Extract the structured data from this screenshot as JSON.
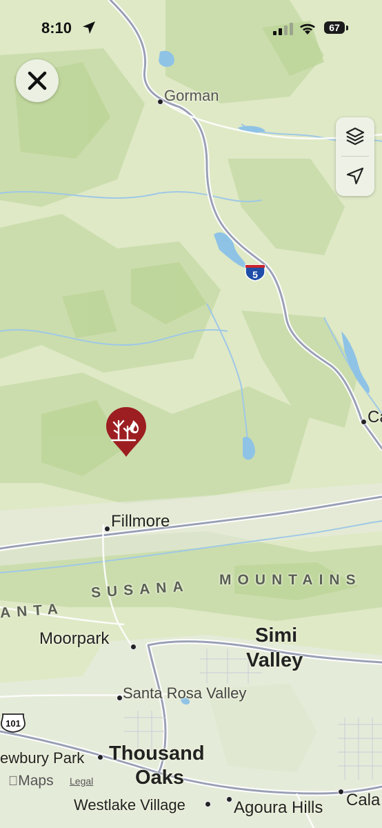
{
  "status_bar": {
    "time": "8:10",
    "battery": "67",
    "icons": [
      "location-arrow-icon",
      "cellular-signal-icon",
      "wifi-icon",
      "battery-icon"
    ]
  },
  "controls": {
    "close_icon": "close-icon",
    "layers_icon": "layers-icon",
    "location_icon": "location-arrow-icon"
  },
  "map": {
    "places": {
      "gorman": "Gorman",
      "castaic_partial": "Ca",
      "fillmore": "Fillmore",
      "moorpark": "Moorpark",
      "simi": "Simi",
      "valley": "Valley",
      "santa_rosa_valley": "Santa Rosa Valley",
      "newbury_park": "ewbury Park",
      "thousand": "Thousand",
      "oaks": "Oaks",
      "westlake_village": "Westlake Village",
      "agoura_hills": "Agoura Hills",
      "calabasas_partial": "Cala"
    },
    "mountains": "SANTA SUSANA MOUNTAINS",
    "mountains_left": "ANTA",
    "mountains_susana": "SUSANA",
    "mountains_mountains": "MOUNTAINS",
    "highway_i5": "5",
    "highway_us101": "101",
    "marker_icon": "wildfire-icon",
    "colors": {
      "land": "#dfe9c6",
      "water": "#8fc3e6",
      "road": "#9aa0b5",
      "fire_marker": "#9c1e21"
    }
  },
  "attribution": {
    "maps": "Maps",
    "legal": "Legal"
  }
}
